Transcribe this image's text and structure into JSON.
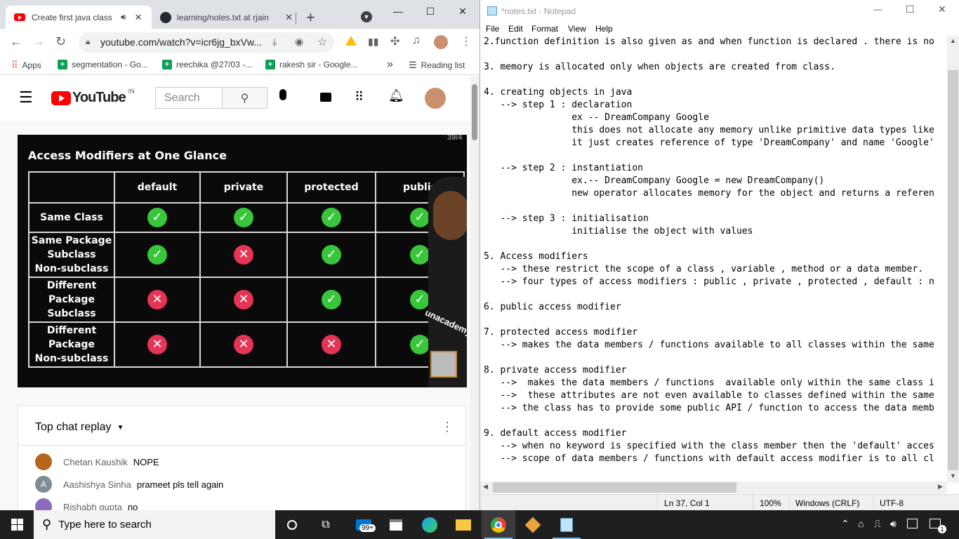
{
  "chrome": {
    "tabs": [
      {
        "title": "Create first java class |",
        "audio_icon": "speaker-icon"
      },
      {
        "title": "learning/notes.txt at rjain"
      }
    ],
    "new_tab_label": "+",
    "url": "youtube.com/watch?v=icr6jg_bxVw...",
    "bookmarks": [
      {
        "label": "Apps"
      },
      {
        "label": "segmentation - Go..."
      },
      {
        "label": "reechika @27/03 -..."
      },
      {
        "label": "rakesh sir - Google..."
      }
    ],
    "bookmarks_more": "»",
    "reading_list": "Reading list"
  },
  "youtube": {
    "logo_text": "YouTube",
    "country": "IN",
    "search_placeholder": "Search",
    "video": {
      "slide_title": "Access Modifiers at One Glance",
      "slide_counter": "39/4",
      "columns": [
        "default",
        "private",
        "protected",
        "public"
      ],
      "rows": [
        {
          "label": [
            "Same Class"
          ],
          "values": [
            "yes",
            "yes",
            "yes",
            "yes"
          ]
        },
        {
          "label": [
            "Same Package",
            "Subclass",
            "Non-subclass"
          ],
          "values": [
            "yes",
            "no",
            "yes",
            "yes"
          ]
        },
        {
          "label": [
            "Different",
            "Package",
            "Subclass"
          ],
          "values": [
            "no",
            "no",
            "yes",
            "yes"
          ]
        },
        {
          "label": [
            "Different",
            "Package",
            "Non-subclass"
          ],
          "values": [
            "no",
            "no",
            "no",
            "yes"
          ]
        }
      ],
      "watermark": "unacademy"
    },
    "chat": {
      "header": "Top chat replay",
      "messages": [
        {
          "name": "Chetan Kaushik",
          "message": "NOPE",
          "avatar_color": "#b5651d"
        },
        {
          "name": "Aashishya Sinha",
          "message": "prameet pls tell again",
          "avatar_letter": "A",
          "avatar_color": "#7e8c94"
        },
        {
          "name": "Rishabh gupta",
          "message": "no",
          "avatar_color": "#8a6bbd"
        }
      ]
    }
  },
  "notepad": {
    "title": "*notes.txt - Notepad",
    "menu": [
      "File",
      "Edit",
      "Format",
      "View",
      "Help"
    ],
    "lines": [
      "2.function definition is also given as and when function is declared . there is no",
      "",
      "3. memory is allocated only when objects are created from class.",
      "",
      "4. creating objects in java",
      "   --> step 1 : declaration",
      "                ex -- DreamCompany Google",
      "                this does not allocate any memory unlike primitive data types like",
      "                it just creates reference of type 'DreamCompany' and name 'Google'",
      "",
      "   --> step 2 : instantiation",
      "                ex.-- DreamCompany Google = new DreamCompany()",
      "                new operator allocates memory for the object and returns a referen",
      "",
      "   --> step 3 : initialisation",
      "                initialise the object with values",
      "",
      "5. Access modifiers",
      "   --> these restrict the scope of a class , variable , method or a data member.",
      "   --> four types of access modifiers : public , private , protected , default : n",
      "",
      "6. public access modifier",
      "",
      "7. protected access modifier",
      "   --> makes the data members / functions available to all classes within the same",
      "",
      "8. private access modifier",
      "   -->  makes the data members / functions  available only within the same class i",
      "   -->  these attributes are not even available to classes defined within the same",
      "   --> the class has to provide some public API / function to access the data memb",
      "",
      "9. default access modifier",
      "   --> when no keyword is specified with the class member then the 'default' acces",
      "   --> scope of data members / functions with default access modifier is to all cl"
    ],
    "status": {
      "position": "Ln 37, Col 1",
      "zoom": "100%",
      "line_ending": "Windows (CRLF)",
      "encoding": "UTF-8"
    }
  },
  "taskbar": {
    "search_placeholder": "Type here to search",
    "mail_badge": "99+",
    "notification_count": "1"
  },
  "colors": {
    "youtube_red": "#ff0000",
    "check_green": "#39c63b",
    "cross_red": "#e53456",
    "taskbar_bg": "#1f1f1f"
  }
}
